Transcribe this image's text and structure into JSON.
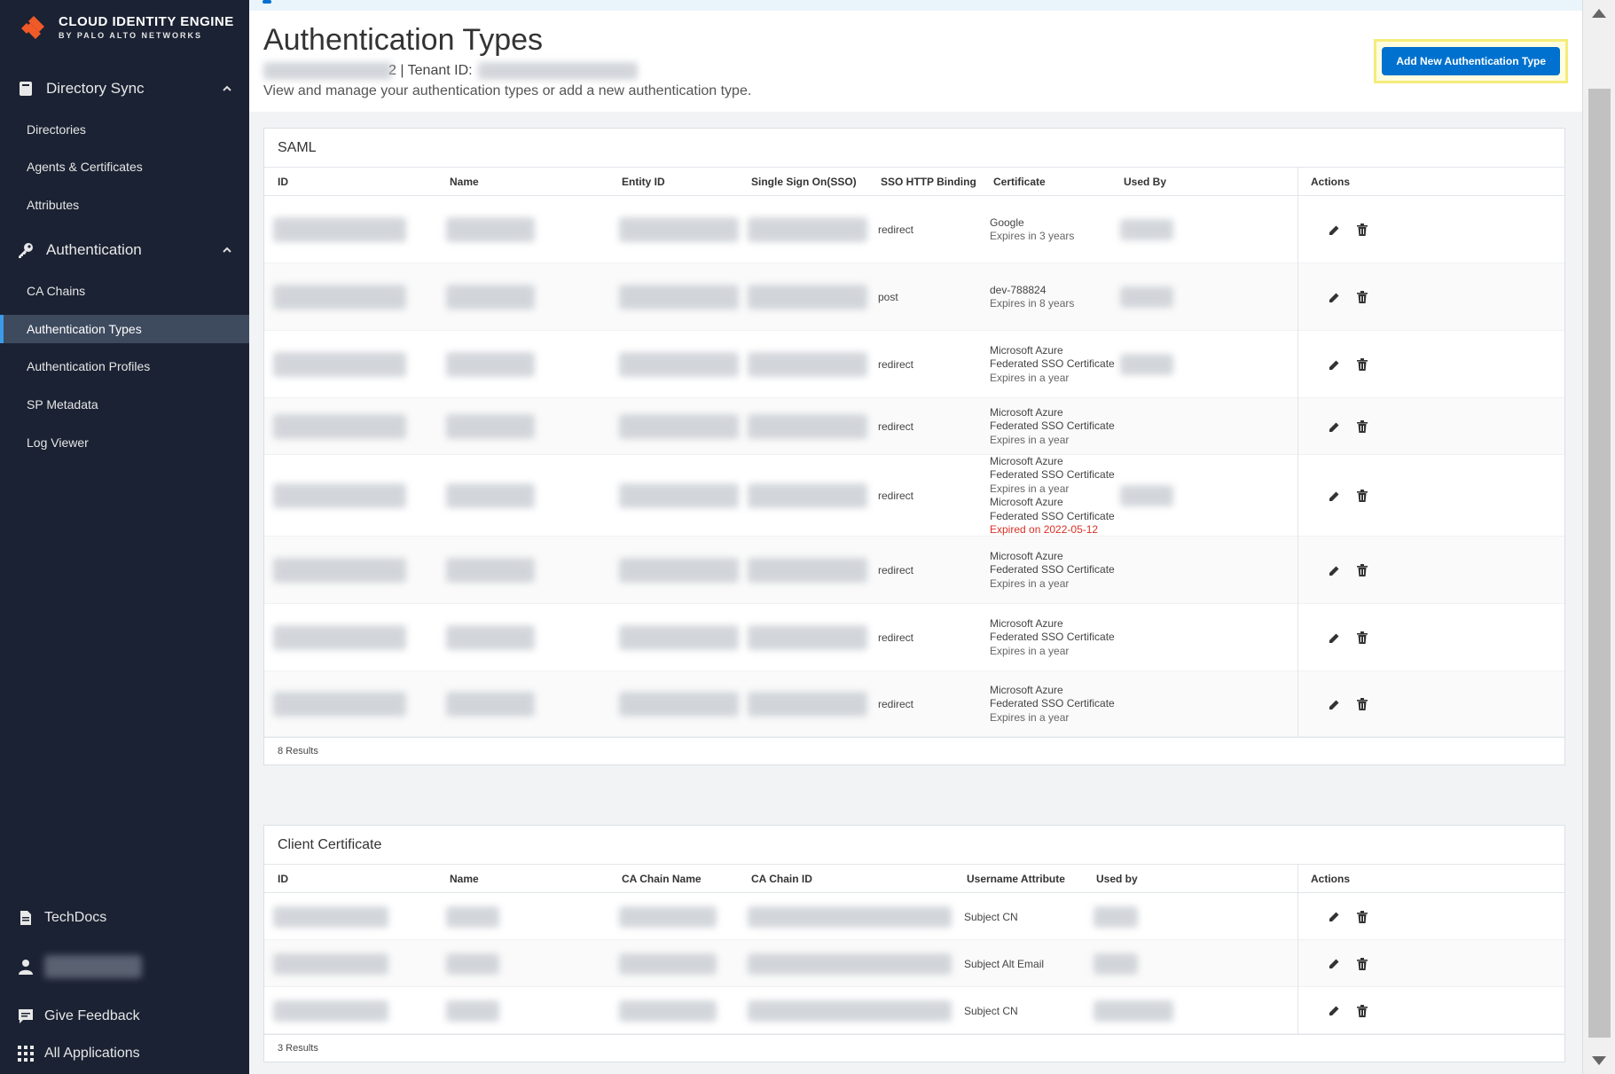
{
  "brand": {
    "title": "CLOUD IDENTITY ENGINE",
    "subtitle": "BY PALO ALTO NETWORKS"
  },
  "sidebar": {
    "directory_sync": {
      "label": "Directory Sync",
      "items": [
        "Directories",
        "Agents & Certificates",
        "Attributes"
      ]
    },
    "authentication": {
      "label": "Authentication",
      "items": [
        "CA Chains",
        "Authentication Types",
        "Authentication Profiles",
        "SP Metadata",
        "Log Viewer"
      ],
      "active": "Authentication Types"
    },
    "bottom": {
      "techdocs": "TechDocs",
      "feedback": "Give Feedback",
      "all_apps": "All Applications"
    }
  },
  "header": {
    "title": "Authentication Types",
    "tenant_label": "2 | Tenant ID:",
    "description": "View and manage your authentication types or add a new authentication type.",
    "add_button": "Add New Authentication Type"
  },
  "saml": {
    "title": "SAML",
    "columns": [
      "ID",
      "Name",
      "Entity ID",
      "Single Sign On(SSO)",
      "SSO HTTP Binding",
      "Certificate",
      "Used By",
      "Actions"
    ],
    "rows": [
      {
        "binding": "redirect",
        "cert": [
          "Google"
        ],
        "exp": "Expires in 3 years",
        "expired": ""
      },
      {
        "binding": "post",
        "cert": [
          "dev-788824"
        ],
        "exp": "Expires in 8 years",
        "expired": ""
      },
      {
        "binding": "redirect",
        "cert": [
          "Microsoft Azure",
          "Federated SSO Certificate"
        ],
        "exp": "Expires in a year",
        "expired": ""
      },
      {
        "binding": "redirect",
        "cert": [
          "Microsoft Azure",
          "Federated SSO Certificate"
        ],
        "exp": "Expires in a year",
        "expired": ""
      },
      {
        "binding": "redirect",
        "cert": [
          "Microsoft Azure",
          "Federated SSO Certificate"
        ],
        "exp": "Expires in a year",
        "cert2": [
          "Microsoft Azure",
          "Federated SSO Certificate"
        ],
        "expired": "Expired on 2022-05-12"
      },
      {
        "binding": "redirect",
        "cert": [
          "Microsoft Azure",
          "Federated SSO Certificate"
        ],
        "exp": "Expires in a year",
        "expired": ""
      },
      {
        "binding": "redirect",
        "cert": [
          "Microsoft Azure",
          "Federated SSO Certificate"
        ],
        "exp": "Expires in a year",
        "expired": ""
      },
      {
        "binding": "redirect",
        "cert": [
          "Microsoft Azure",
          "Federated SSO Certificate"
        ],
        "exp": "Expires in a year",
        "expired": ""
      }
    ],
    "results": "8 Results"
  },
  "client_cert": {
    "title": "Client Certificate",
    "columns": [
      "ID",
      "Name",
      "CA Chain Name",
      "CA Chain ID",
      "Username Attribute",
      "Used by",
      "Actions"
    ],
    "rows": [
      {
        "username_attr": "Subject CN"
      },
      {
        "username_attr": "Subject Alt Email"
      },
      {
        "username_attr": "Subject CN"
      }
    ],
    "results": "3 Results"
  },
  "icons": {
    "edit": "pencil-icon",
    "delete": "trash-icon"
  },
  "colors": {
    "sidebar": "#1b2233",
    "accent": "#0071ce",
    "expired": "#d93025"
  }
}
